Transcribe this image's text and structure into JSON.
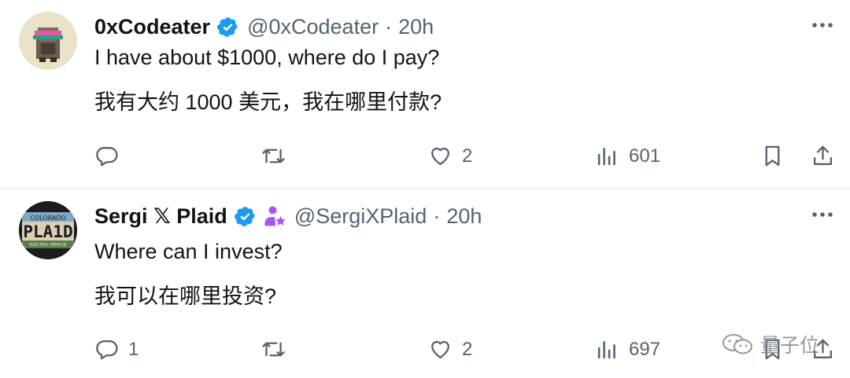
{
  "tweets": [
    {
      "name": "0xCodeater",
      "handle": "@0xCodeater",
      "separator": "·",
      "time": "20h",
      "text_en": "I have about $1000, where do I pay?",
      "text_zh": "我有大约 1000 美元，我在哪里付款?",
      "replies": "",
      "likes": "2",
      "views": "601"
    },
    {
      "name": "Sergi 𝕏 Plaid",
      "handle": "@SergiXPlaid",
      "separator": "·",
      "time": "20h",
      "avatar_lines": [
        "COLORADO",
        "PLA1D",
        "ELECTRIC VEHICLE"
      ],
      "text_en": "Where can I invest?",
      "text_zh": "我可以在哪里投资?",
      "replies": "1",
      "likes": "2",
      "views": "697"
    }
  ],
  "watermark": "量子位",
  "colors": {
    "verified": "#1d9bf0",
    "text": "#0f1419",
    "muted": "#536471",
    "badge": "#a855f7"
  }
}
